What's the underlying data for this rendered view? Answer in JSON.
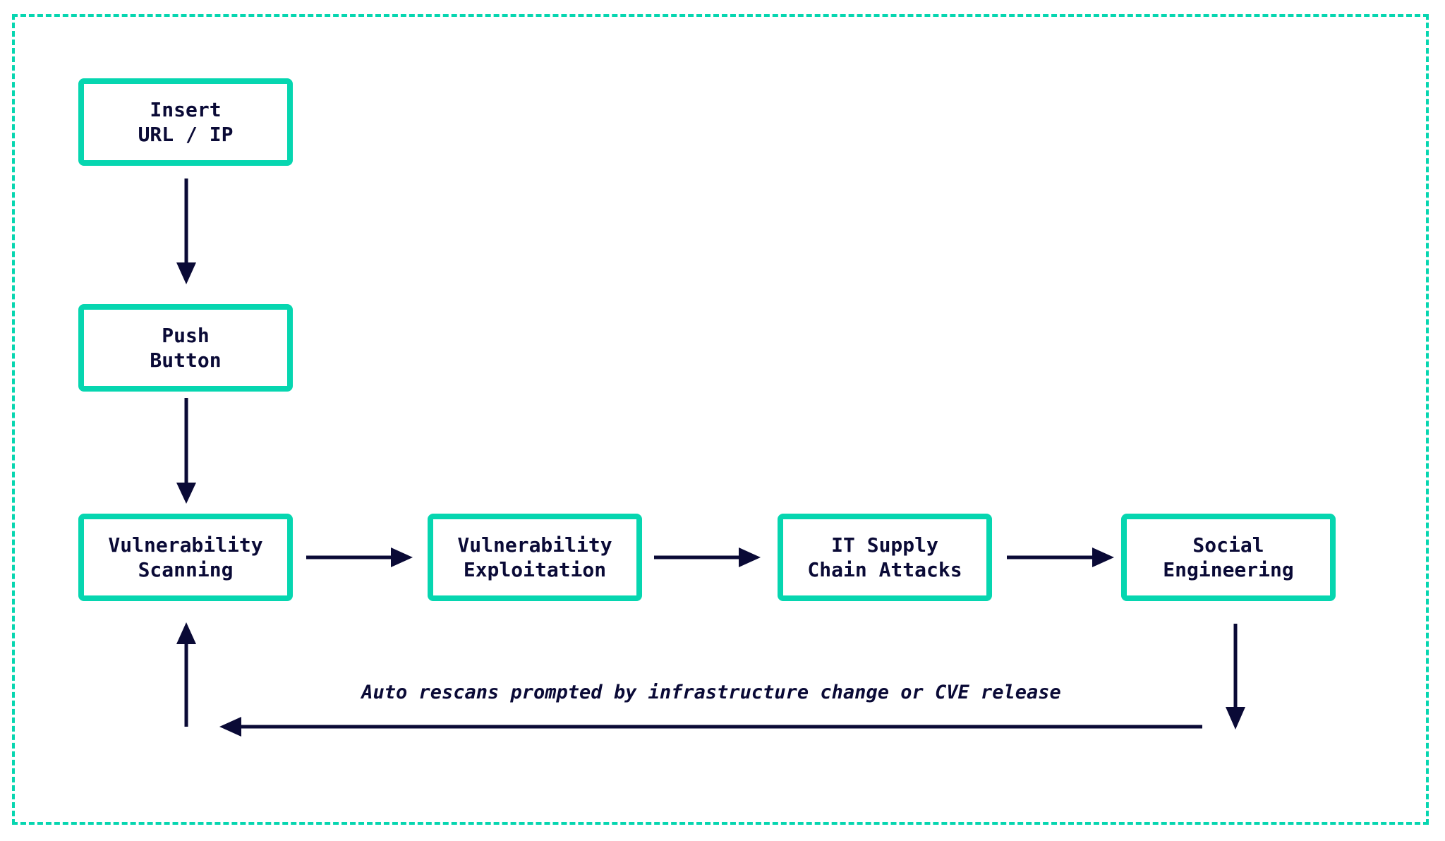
{
  "colors": {
    "box_border": "#06d6b0",
    "arrow": "#0a0a36",
    "frame": "#06d6b0"
  },
  "nodes": {
    "insert": {
      "line1": "Insert",
      "line2": "URL / IP"
    },
    "push": {
      "line1": "Push",
      "line2": "Button"
    },
    "scanning": {
      "line1": "Vulnerability",
      "line2": "Scanning"
    },
    "exploitation": {
      "line1": "Vulnerability",
      "line2": "Exploitation"
    },
    "supply": {
      "line1": "IT Supply",
      "line2": "Chain Attacks"
    },
    "social": {
      "line1": "Social",
      "line2": "Engineering"
    }
  },
  "loop_caption": "Auto rescans prompted by infrastructure change or CVE release"
}
